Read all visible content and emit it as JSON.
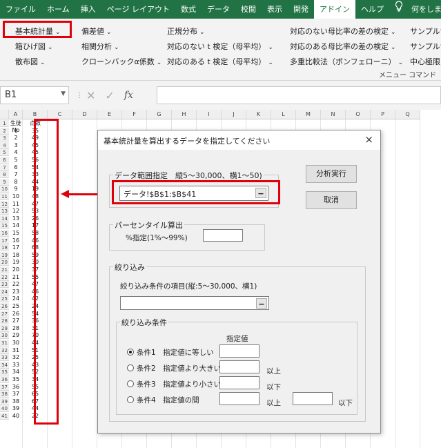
{
  "ribbon_tabs": [
    "ファイル",
    "ホーム",
    "挿入",
    "ページ レイアウト",
    "数式",
    "データ",
    "校閲",
    "表示",
    "開発",
    "アドイン",
    "ヘルプ",
    "何をしますか"
  ],
  "ribbon": {
    "col1": [
      "基本統計量",
      "箱ひげ図",
      "散布図"
    ],
    "col2": [
      "偏差値",
      "相関分析",
      "クローンバックα係数"
    ],
    "col3": [
      "正規分布",
      "対応のない t 検定（母平均）",
      "対応のある t 検定（母平均）"
    ],
    "col4": [
      "対応のない母比率の差の検定",
      "対応のある母比率の差の検定",
      "多重比較法（ボンフェローニ）"
    ],
    "col5": [
      "サンプルサ",
      "サンプルサ",
      "中心極限"
    ],
    "group_label": "メニュー コマンド"
  },
  "formula_bar": {
    "name_box": "B1",
    "fx_label": "fx",
    "formula": ""
  },
  "grid": {
    "columns": [
      "A",
      "B",
      "C",
      "D",
      "E",
      "F",
      "G",
      "H",
      "I",
      "J",
      "K",
      "L",
      "M",
      "N",
      "O",
      "P",
      "Q"
    ],
    "header_a": "生徒No",
    "header_b": "点数",
    "rows": [
      [
        "1",
        "35"
      ],
      [
        "2",
        "49"
      ],
      [
        "3",
        "45"
      ],
      [
        "4",
        "45"
      ],
      [
        "5",
        "56"
      ],
      [
        "6",
        "54"
      ],
      [
        "7",
        "33"
      ],
      [
        "8",
        "44"
      ],
      [
        "9",
        "19"
      ],
      [
        "10",
        "48"
      ],
      [
        "11",
        "47"
      ],
      [
        "12",
        "53"
      ],
      [
        "13",
        "26"
      ],
      [
        "14",
        "17"
      ],
      [
        "15",
        "58"
      ],
      [
        "16",
        "46"
      ],
      [
        "17",
        "68"
      ],
      [
        "18",
        "59"
      ],
      [
        "19",
        "30"
      ],
      [
        "20",
        "37"
      ],
      [
        "21",
        "55"
      ],
      [
        "22",
        "47"
      ],
      [
        "23",
        "46"
      ],
      [
        "24",
        "42"
      ],
      [
        "25",
        "24"
      ],
      [
        "26",
        "54"
      ],
      [
        "27",
        "36"
      ],
      [
        "28",
        "31"
      ],
      [
        "29",
        "70"
      ],
      [
        "30",
        "44"
      ],
      [
        "31",
        "51"
      ],
      [
        "32",
        "25"
      ],
      [
        "33",
        "43"
      ],
      [
        "34",
        "52"
      ],
      [
        "35",
        "34"
      ],
      [
        "36",
        "55"
      ],
      [
        "37",
        "65"
      ],
      [
        "38",
        "67"
      ],
      [
        "39",
        "44"
      ],
      [
        "40",
        "22"
      ]
    ]
  },
  "dialog": {
    "title": "基本統計量を算出するデータを指定してください",
    "close_icon": "×",
    "range_frame_label": "データ範囲指定　縦5～30,000、横1～50)",
    "range_value": "データ!$B$1:$B$41",
    "analyze_button": "分析実行",
    "cancel_button": "取消",
    "percentile_frame_label": "パーセンタイル算出",
    "percentile_label": "%指定(1%～99%)",
    "filter_frame_label": "絞り込み",
    "filter_item_label": "絞り込み条件の項目(縦:5～30,000、横1)",
    "filter_cond_frame_label": "絞り込み条件",
    "spec_value_header": "指定値",
    "cond1": "条件1　指定値に等しい",
    "cond2": "条件2　指定値より大きい",
    "cond3": "条件3　指定値より小さい",
    "cond4": "条件4　指定値の間",
    "above_label": "以上",
    "below_label": "以下",
    "combo_button_glyph": "▁"
  }
}
